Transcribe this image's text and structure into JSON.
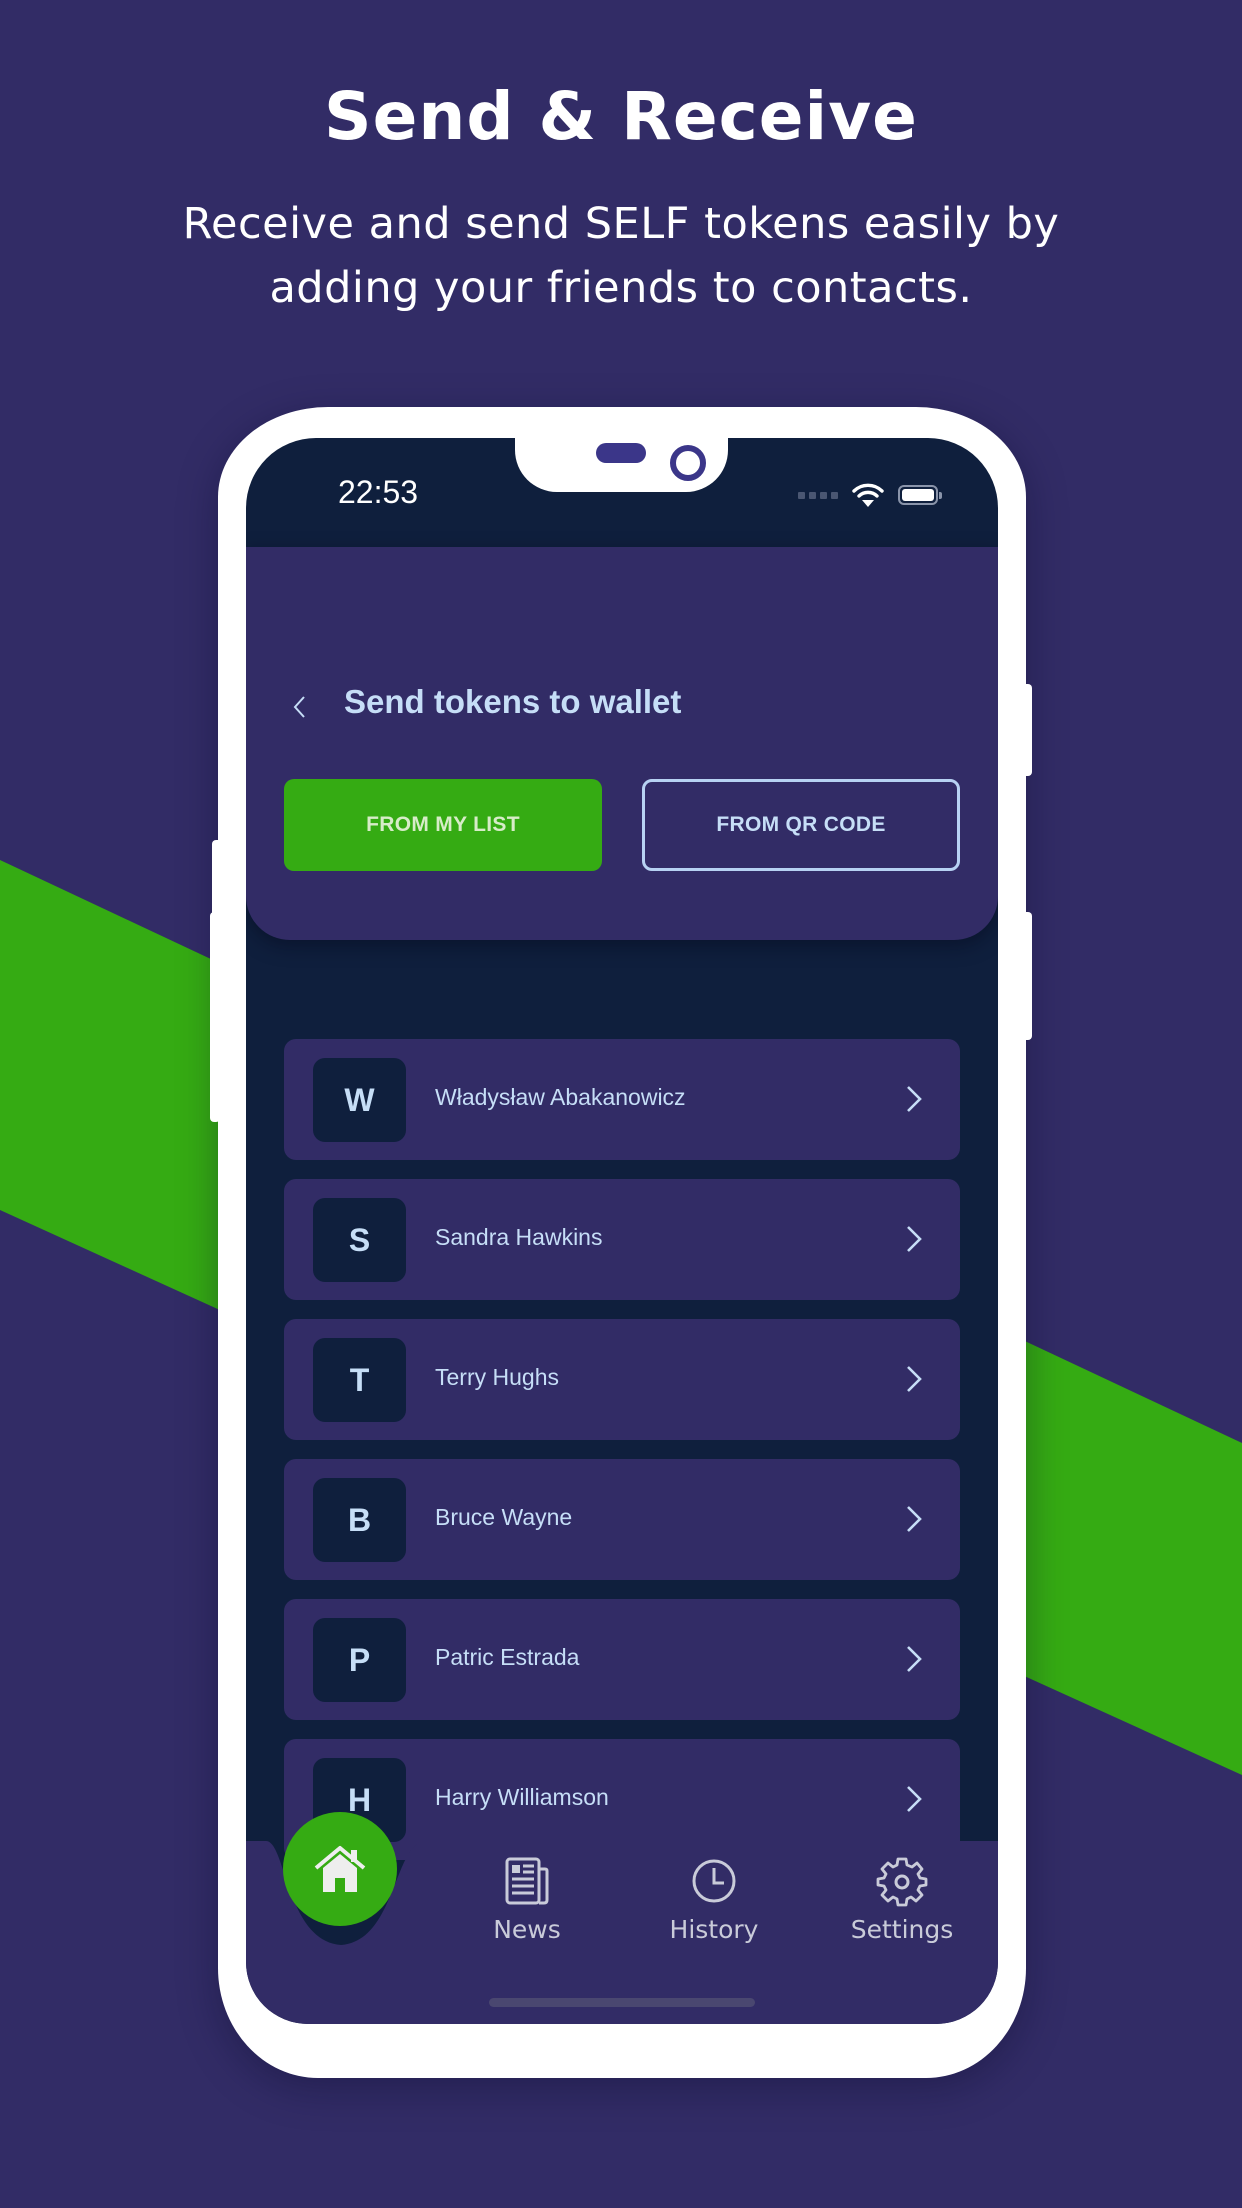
{
  "promo": {
    "title": "Send & Receive",
    "subtitle": "Receive and send SELF tokens easily by adding your friends to contacts."
  },
  "colors": {
    "background": "#322c66",
    "accent_green": "#35ab13",
    "screen_dark": "#0f1f3d",
    "text_light_blue": "#c6def7",
    "phone_frame": "#ffffff"
  },
  "status_bar": {
    "time": "22:53",
    "icons": [
      "signal-icon",
      "wifi-icon",
      "battery-icon"
    ]
  },
  "header": {
    "back_icon": "chevron-left-icon",
    "title": "Send tokens to wallet"
  },
  "actions": {
    "from_list_label": "FROM MY LIST",
    "from_qr_label": "FROM QR CODE",
    "active": "from_list"
  },
  "contacts": [
    {
      "initial": "W",
      "name": "Władysław Abakanowicz"
    },
    {
      "initial": "S",
      "name": "Sandra Hawkins"
    },
    {
      "initial": "T",
      "name": "Terry Hughs"
    },
    {
      "initial": "B",
      "name": "Bruce Wayne"
    },
    {
      "initial": "P",
      "name": "Patric Estrada"
    },
    {
      "initial": "H",
      "name": "Harry Williamson"
    }
  ],
  "bottom_nav": {
    "home": {
      "icon": "home-icon",
      "active": true
    },
    "items": [
      {
        "label": "News",
        "icon": "newspaper-icon"
      },
      {
        "label": "History",
        "icon": "clock-icon"
      },
      {
        "label": "Settings",
        "icon": "gear-icon"
      }
    ]
  }
}
